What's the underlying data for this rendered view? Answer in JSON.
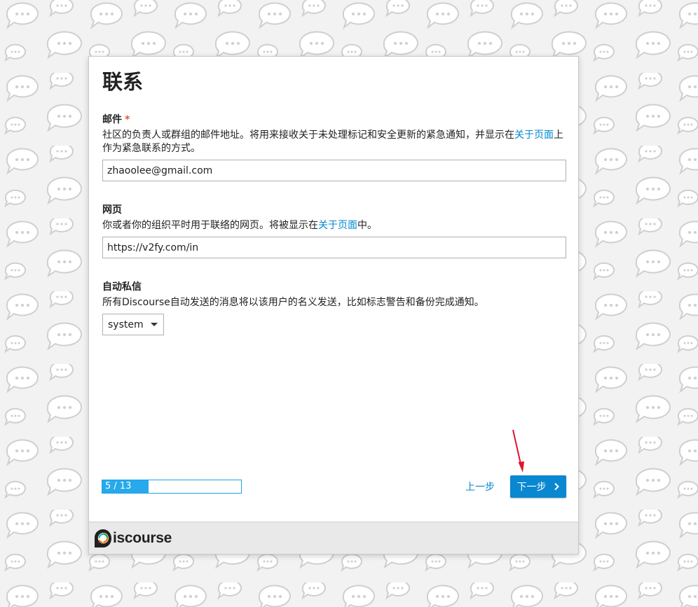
{
  "step": {
    "title": "联系"
  },
  "fields": {
    "email": {
      "label": "邮件",
      "required_mark": "*",
      "desc_before": "社区的负责人或群组的邮件地址。将用来接收关于未处理标记和安全更新的紧急通知，并显示在",
      "desc_link": "关于页面",
      "desc_after": "上作为紧急联系的方式。",
      "value": "zhaoolee@gmail.com"
    },
    "website": {
      "label": "网页",
      "desc_before": "你或者你的组织平时用于联络的网页。将被显示在",
      "desc_link": "关于页面",
      "desc_after": "中。",
      "value": "https://v2fy.com/in"
    },
    "pm": {
      "label": "自动私信",
      "desc": "所有Discourse自动发送的消息将以该用户的名义发送，比如标志警告和备份完成通知。",
      "selected": "system"
    }
  },
  "progress": {
    "text": "5 / 13",
    "fraction": 0.3333
  },
  "nav": {
    "back_label": "上一步",
    "next_label": "下一步"
  },
  "footer": {
    "logo_text": "iscourse"
  },
  "colors": {
    "accent": "#0a87d1",
    "link": "#0088cc",
    "required": "#e45735",
    "progress": "#27a9ec"
  }
}
